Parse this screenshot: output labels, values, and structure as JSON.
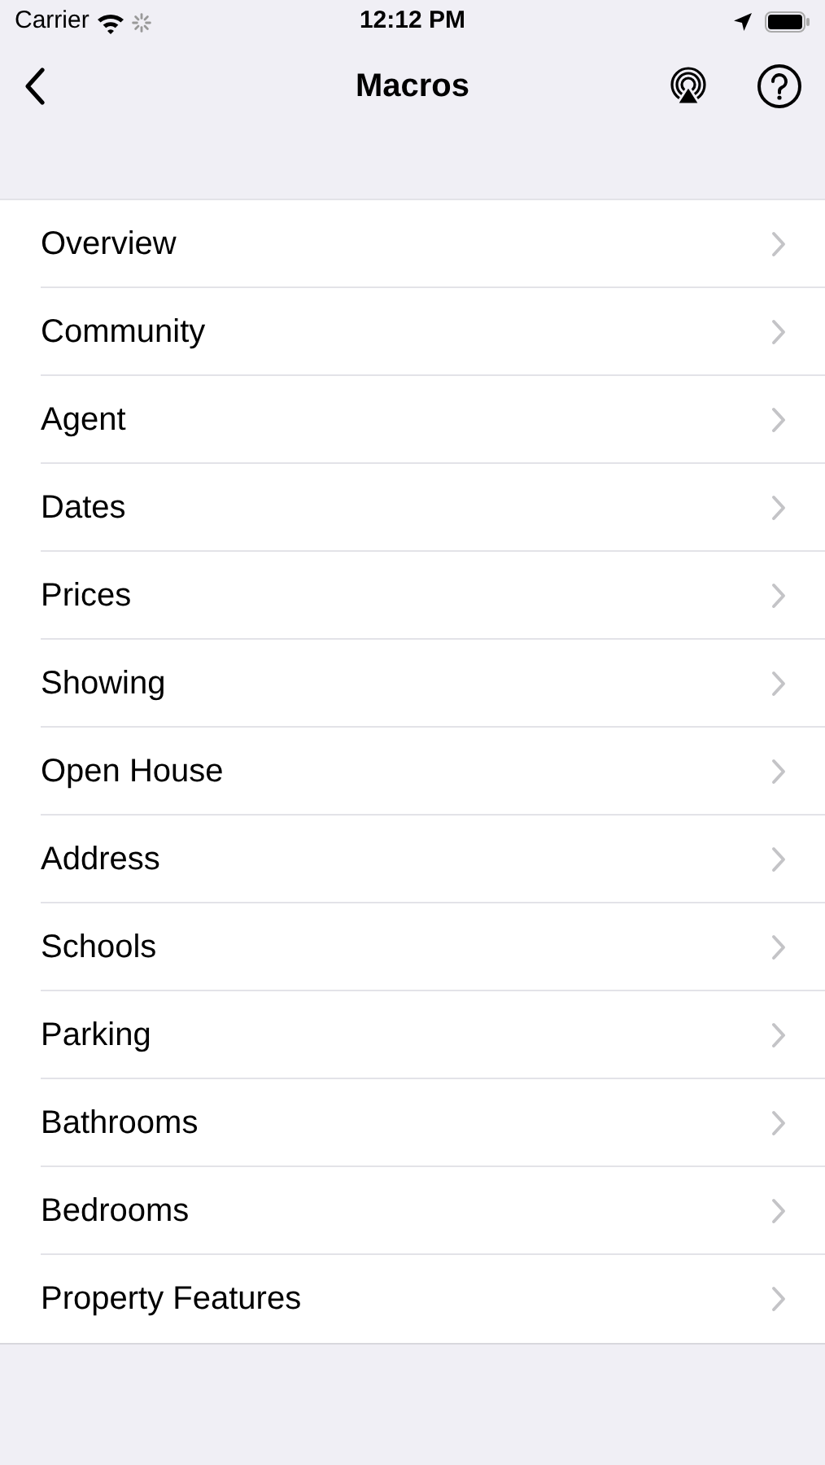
{
  "status_bar": {
    "carrier": "Carrier",
    "time": "12:12 PM"
  },
  "nav": {
    "title": "Macros"
  },
  "items": [
    {
      "label": "Overview"
    },
    {
      "label": "Community"
    },
    {
      "label": "Agent"
    },
    {
      "label": "Dates"
    },
    {
      "label": "Prices"
    },
    {
      "label": "Showing"
    },
    {
      "label": "Open House"
    },
    {
      "label": "Address"
    },
    {
      "label": "Schools"
    },
    {
      "label": "Parking"
    },
    {
      "label": "Bathrooms"
    },
    {
      "label": "Bedrooms"
    },
    {
      "label": "Property Features"
    }
  ]
}
